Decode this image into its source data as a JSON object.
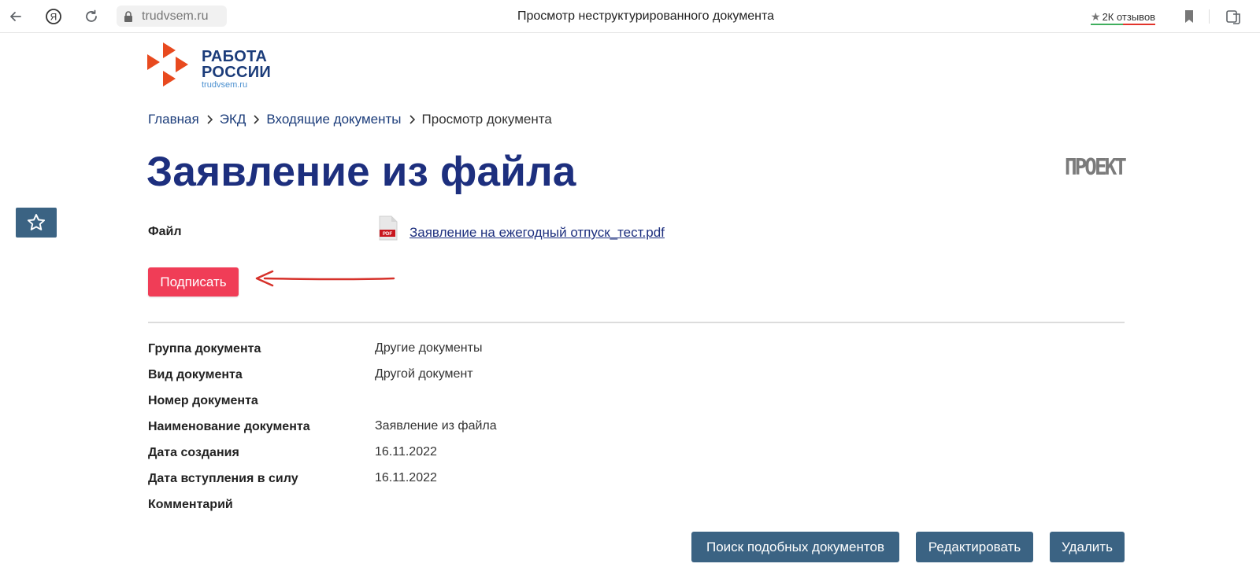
{
  "browser": {
    "url": "trudvsem.ru",
    "tab_title": "Просмотр неструктурированного документа",
    "reviews": "2К отзывов"
  },
  "logo": {
    "line1": "РАБОТА",
    "line2": "РОССИИ",
    "sub": "trudvsem.ru",
    "colors": {
      "arrows": "#e84a1f",
      "text": "#1b3c7a",
      "sub": "#4a8fcf"
    }
  },
  "breadcrumb": {
    "items": [
      "Главная",
      "ЭКД",
      "Входящие документы"
    ],
    "current": "Просмотр документа"
  },
  "page": {
    "title": "Заявление из файла",
    "status": "ПРОЕКТ"
  },
  "file": {
    "label": "Файл",
    "name": "Заявление на ежегодный отпуск_тест.pdf",
    "icon_label": "PDF"
  },
  "sign_button": "Подписать",
  "properties": [
    {
      "key": "Группа документа",
      "value": "Другие документы"
    },
    {
      "key": "Вид документа",
      "value": "Другой документ"
    },
    {
      "key": "Номер документа",
      "value": ""
    },
    {
      "key": "Наименование документа",
      "value": "Заявление из файла"
    },
    {
      "key": "Дата создания",
      "value": "16.11.2022"
    },
    {
      "key": "Дата вступления в силу",
      "value": "16.11.2022"
    },
    {
      "key": "Комментарий",
      "value": ""
    }
  ],
  "actions": {
    "search_similar": "Поиск подобных документов",
    "edit": "Редактировать",
    "delete": "Удалить"
  },
  "colors": {
    "primary": "#3b6383",
    "sign": "#f03d57",
    "title": "#1d2f7e",
    "annotation_arrow": "#d6312a"
  }
}
